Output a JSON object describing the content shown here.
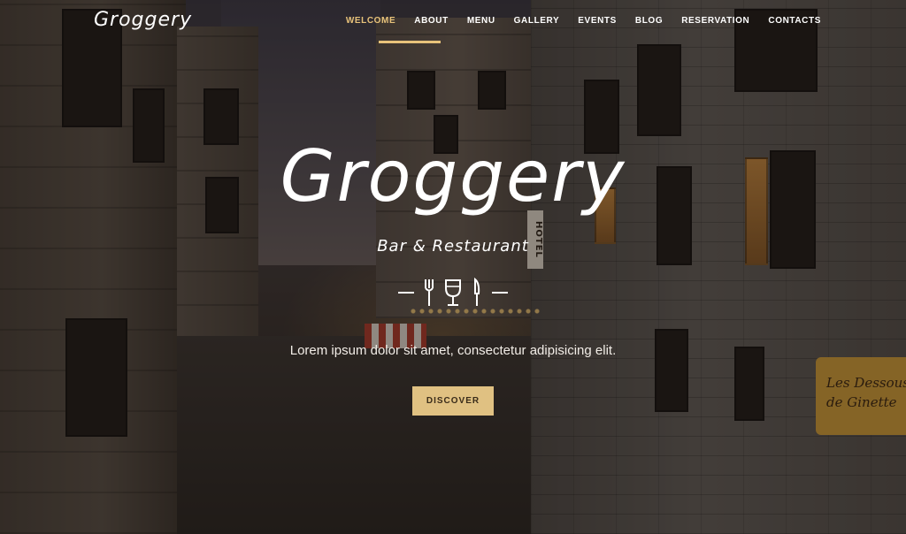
{
  "header": {
    "logo": "Groggery",
    "nav": [
      {
        "label": "WELCOME",
        "active": true
      },
      {
        "label": "ABOUT",
        "active": false
      },
      {
        "label": "MENU",
        "active": false
      },
      {
        "label": "GALLERY",
        "active": false
      },
      {
        "label": "EVENTS",
        "active": false
      },
      {
        "label": "BLOG",
        "active": false
      },
      {
        "label": "RESERVATION",
        "active": false
      },
      {
        "label": "CONTACTS",
        "active": false
      }
    ]
  },
  "hero": {
    "title": "Groggery",
    "subtitle": "Bar & Restaurant",
    "divider_icons": [
      "fork-icon",
      "wine-glass-icon",
      "knife-icon"
    ],
    "tagline": "Lorem ipsum dolor sit amet, consectetur adipisicing elit.",
    "cta_label": "DISCOVER"
  },
  "background": {
    "hotel_sign": "HOTEL",
    "shop_sign": "Les Dessous de Ginette"
  },
  "colors": {
    "accent": "#e7c27a",
    "button_bg": "#e0c182",
    "text": "#ffffff"
  }
}
